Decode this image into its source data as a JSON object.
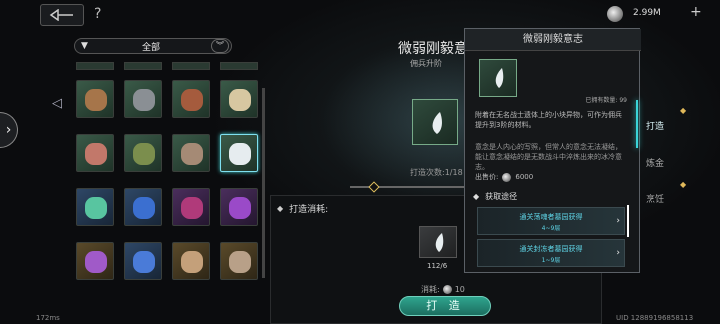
{
  "topbar": {
    "help": "?",
    "currency": "2.99M",
    "plus": "+"
  },
  "filter": {
    "label": "全部"
  },
  "grid": {
    "cells": [
      {
        "tier": "green",
        "color": "#a6754a",
        "shape": "log"
      },
      {
        "tier": "green",
        "color": "#8a8f94",
        "shape": "ore"
      },
      {
        "tier": "green",
        "color": "#a55b3d",
        "shape": "hide"
      },
      {
        "tier": "green",
        "color": "#d7c7a1",
        "shape": "fang"
      },
      {
        "tier": "green",
        "color": "#c2786a",
        "shape": "scroll"
      },
      {
        "tier": "green",
        "color": "#7b8e4d",
        "shape": "herb"
      },
      {
        "tier": "green",
        "color": "#a58a75",
        "shape": "shell"
      },
      {
        "tier": "green",
        "color": "#e6ecef",
        "shape": "wisp"
      },
      {
        "tier": "blue",
        "color": "#58c5a0",
        "shape": "vial"
      },
      {
        "tier": "blue",
        "color": "#3b6fd0",
        "shape": "crystal"
      },
      {
        "tier": "purple",
        "color": "#b03a7a",
        "shape": "orb"
      },
      {
        "tier": "purple",
        "color": "#9a4ac8",
        "shape": "gem"
      },
      {
        "tier": "gold",
        "color": "#a05ac8",
        "shape": "cluster"
      },
      {
        "tier": "blue",
        "color": "#4a7bd8",
        "shape": "shard"
      },
      {
        "tier": "gold",
        "color": "#c4a07a",
        "shape": "portrait"
      },
      {
        "tier": "gold",
        "color": "#b8a088",
        "shape": "portrait"
      }
    ],
    "selected_index": 7
  },
  "center": {
    "title": "微弱刚毅意志",
    "subtitle": "佣兵升阶",
    "craft_count": "打造次数:1/18"
  },
  "cost": {
    "header": "打造消耗:",
    "material_count": "112/6",
    "cost_label": "消耗:",
    "cost_value": "10",
    "craft_button": "打 造"
  },
  "tooltip": {
    "title": "微弱刚毅意志",
    "owned": "已拥有数量: 99",
    "desc": "附着在无名战士遗体上的小块异物，可作为佣兵提升到3阶的材料。",
    "lore": "意念是人内心的写照，但常人的意念无法凝结，能让意念凝结的是无数战斗中淬炼出来的冰冷意志。",
    "price_label": "出售价:",
    "price_value": "6000",
    "source_header": "获取途径",
    "sources": [
      {
        "text": "通关荡魂者墓园获得",
        "levels": "4~9层"
      },
      {
        "text": "通关封冻者墓园获得",
        "levels": "1~9层"
      }
    ]
  },
  "right_tabs": [
    "打造",
    "炼金",
    "烹饪"
  ],
  "footer": {
    "fps": "172ms",
    "uid": "UID 12889196858113"
  },
  "colors": {
    "accent": "#3ad4d8",
    "source_text": "#5fd4e6",
    "button": "#2fa48e"
  }
}
